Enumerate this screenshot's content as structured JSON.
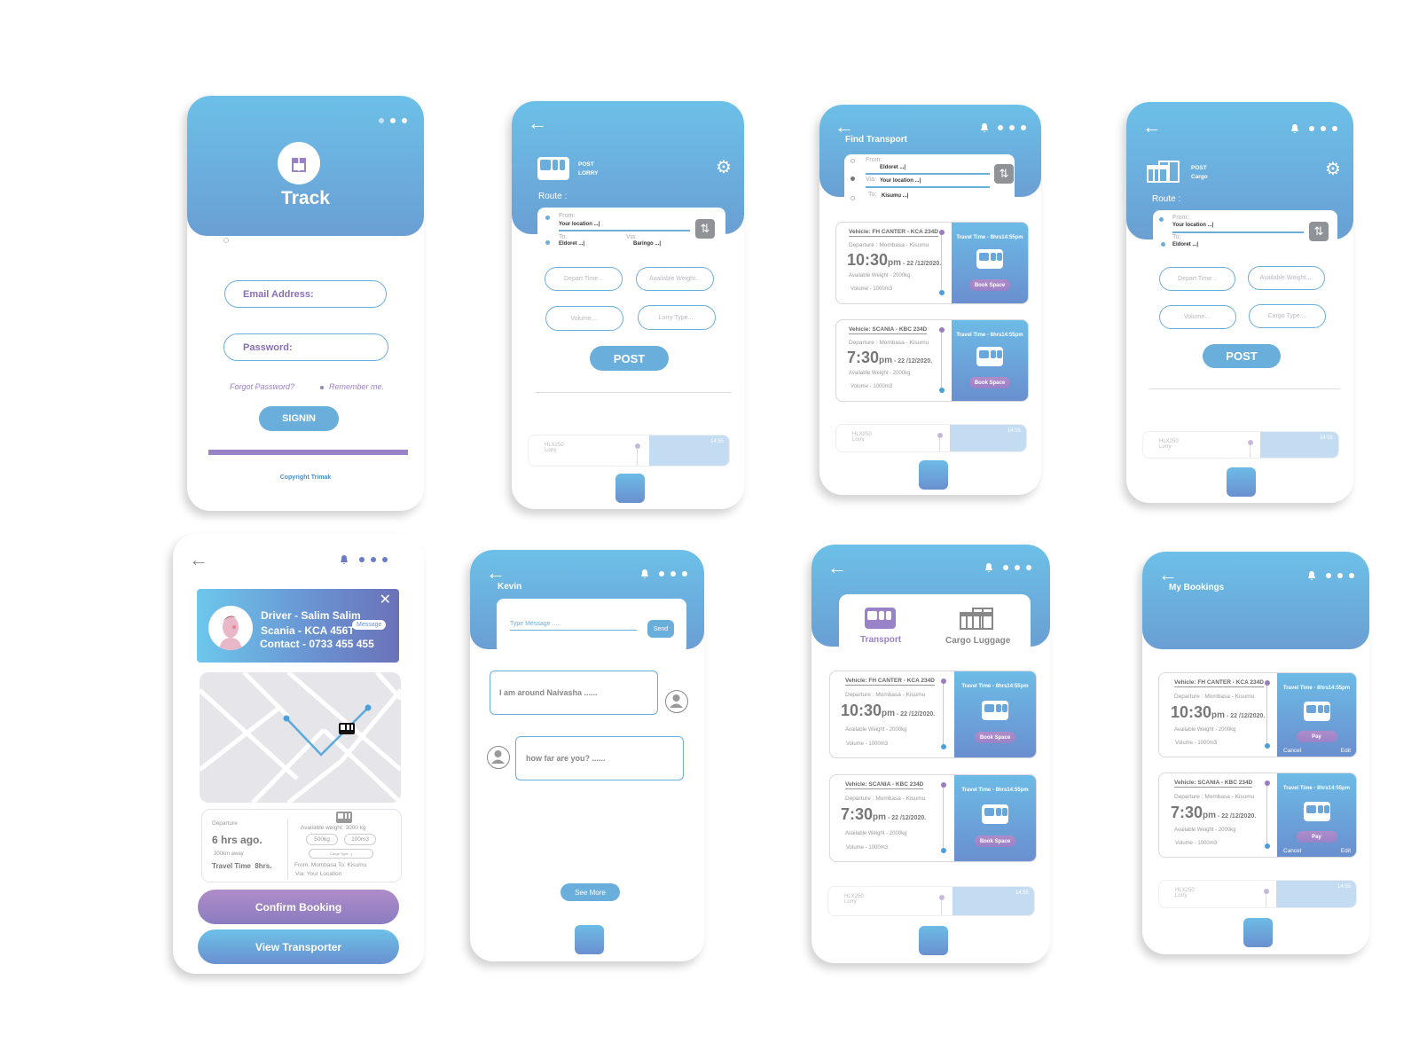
{
  "login": {
    "app_title": "Track",
    "email_placeholder": "Email Address:",
    "password_placeholder": "Password:",
    "forgot_password": "Forgot Password?",
    "remember_me": "Remember me.",
    "signin": "SIGNIN",
    "copyright": "Copyright Trimak"
  },
  "post_lorry": {
    "title_line1": "POST",
    "title_line2": "LORRY",
    "route_label": "Route :",
    "from_label": "From:",
    "from_value": "Your location ...|",
    "to_label": "To:",
    "to_value": "Eldoret ...|",
    "via_label": "Via:",
    "via_value": "Baringo ...|",
    "depart_time": "Depart Time ..",
    "available_weight": "Available Weight...",
    "volume": "Volume....",
    "lorry_type": "Lorry Type....",
    "post": "POST",
    "preview_title": "HLX250",
    "preview_sub": "Lorry",
    "preview_time": "14:55"
  },
  "find_transport": {
    "title": "Find Transport",
    "from_label": "From:",
    "from_value": "Eldoret ...|",
    "via_label": "Via:",
    "via_value": "Your location ...|",
    "to_label": "To:",
    "to_value": "Kisumu ...|",
    "preview_title": "HLX250",
    "preview_sub": "Lorry",
    "preview_time": "14:55"
  },
  "post_cargo": {
    "title_line1": "POST",
    "title_line2": "Cargo",
    "route_label": "Route :",
    "from_label": "From:",
    "from_value": "Your location ...|",
    "to_label": "To:",
    "to_value": "Eldoret ...|",
    "depart_time": "Depart Time ..",
    "available_weight": "Available Weight....",
    "volume": "Volume....",
    "cargo_type": "Cargo Type....",
    "post": "POST",
    "preview_title": "HLX250",
    "preview_sub": "Lorry",
    "preview_time": "14:55"
  },
  "vehicles": [
    {
      "vehicle": "Vehicle: FH CANTER - KCA 234D",
      "departure": "Departure : Mombasa - Kisumu",
      "time": "10:30",
      "ampm": "pm",
      "date": " - 22 /12/2020.",
      "weight": "Available Weight - 2000kg",
      "volume": "Volume - 1000m3",
      "travel_time": "Travel Time - 8hrs14:55pm",
      "book": "Book Space"
    },
    {
      "vehicle": "Vehicle: SCANIA - KBC 234D",
      "departure": "Departure : Mombasa - Kisumu",
      "time": "7:30",
      "ampm": "pm",
      "date": " - 22 /12/2020.",
      "weight": "Available Weight - 2000kg",
      "volume": "Volume - 1000m3",
      "travel_time": "Travel Time - 8hrs14:55pm",
      "book": "Book Space"
    }
  ],
  "driver": {
    "name": "Driver - Salim Salim",
    "vehicle": "Scania - KCA 456T",
    "contact": "Contact - 0733 455 455",
    "message": "Message",
    "departure_label": "Departure",
    "departure_value": "6 hrs ago.",
    "distance": "300km away",
    "travel_time": "Travel Time  8hrs.",
    "available_weight": "Available weight: 3000 kg",
    "chip_weight": "500kg",
    "chip_volume": "100m3",
    "cargo_type": "Cargo Type...|",
    "from_to": "From: Mombasa To: Kisumu",
    "via": "Via: Your Location",
    "confirm": "Confirm Booking",
    "view": "View Transporter"
  },
  "chat": {
    "contact_name": "Kevin",
    "input_placeholder": "Type Message .....",
    "send": "Send",
    "messages": [
      {
        "text": "I am around Naivasha ......",
        "side": "outgoing"
      },
      {
        "text": "how far are you? ......",
        "side": "incoming"
      }
    ],
    "see_more": "See More"
  },
  "tabs_screen": {
    "tab_transport": "Transport",
    "tab_cargo": "Cargo Luggage",
    "preview_title": "HLX250",
    "preview_sub": "Lorry",
    "preview_time": "14:55"
  },
  "bookings": {
    "title": "My Bookings",
    "pay": "Pay",
    "cancel": "Cancel",
    "edit": "Edit",
    "preview_title": "HLX250",
    "preview_sub": "Lorry",
    "preview_time": "14:55"
  },
  "colors": {
    "header_top": "#6cc0e8",
    "header_bottom": "#6a9fd4",
    "accent_purple": "#9a82c8",
    "button_blue": "#6aaedc"
  }
}
